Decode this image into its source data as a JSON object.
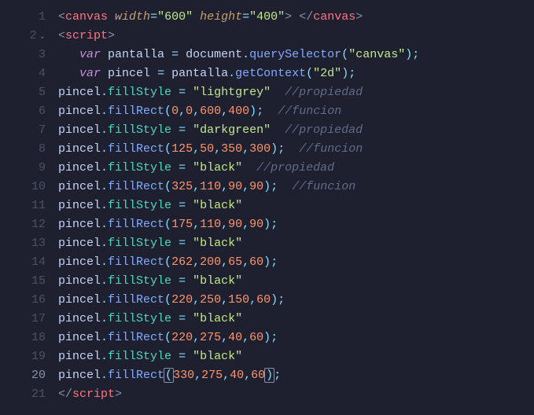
{
  "tokens": [
    [
      {
        "c": "c-bracket",
        "t": "<"
      },
      {
        "c": "c-tag",
        "t": "canvas"
      },
      {
        "c": "",
        "t": " "
      },
      {
        "c": "c-attr",
        "t": "width"
      },
      {
        "c": "c-op",
        "t": "="
      },
      {
        "c": "c-string",
        "t": "\"600\""
      },
      {
        "c": "",
        "t": " "
      },
      {
        "c": "c-attr",
        "t": "height"
      },
      {
        "c": "c-op",
        "t": "="
      },
      {
        "c": "c-string",
        "t": "\"400\""
      },
      {
        "c": "c-bracket",
        "t": ">"
      },
      {
        "c": "",
        "t": " "
      },
      {
        "c": "c-bracket",
        "t": "</"
      },
      {
        "c": "c-tag",
        "t": "canvas"
      },
      {
        "c": "c-bracket",
        "t": ">"
      }
    ],
    [
      {
        "c": "c-bracket",
        "t": "<"
      },
      {
        "c": "c-tag",
        "t": "script"
      },
      {
        "c": "c-bracket",
        "t": ">"
      }
    ],
    [
      {
        "c": "",
        "t": "   "
      },
      {
        "c": "c-var",
        "t": "var"
      },
      {
        "c": "",
        "t": " "
      },
      {
        "c": "c-ident",
        "t": "pantalla"
      },
      {
        "c": "",
        "t": " "
      },
      {
        "c": "c-op",
        "t": "="
      },
      {
        "c": "",
        "t": " "
      },
      {
        "c": "c-ident",
        "t": "document"
      },
      {
        "c": "c-punc",
        "t": "."
      },
      {
        "c": "c-func",
        "t": "querySelector"
      },
      {
        "c": "c-punc",
        "t": "("
      },
      {
        "c": "c-string",
        "t": "\"canvas\""
      },
      {
        "c": "c-punc",
        "t": ")"
      },
      {
        "c": "c-punc",
        "t": ";"
      }
    ],
    [
      {
        "c": "",
        "t": "   "
      },
      {
        "c": "c-var",
        "t": "var"
      },
      {
        "c": "",
        "t": " "
      },
      {
        "c": "c-ident",
        "t": "pincel"
      },
      {
        "c": "",
        "t": " "
      },
      {
        "c": "c-op",
        "t": "="
      },
      {
        "c": "",
        "t": " "
      },
      {
        "c": "c-ident",
        "t": "pantalla"
      },
      {
        "c": "c-punc",
        "t": "."
      },
      {
        "c": "c-func",
        "t": "getContext"
      },
      {
        "c": "c-punc",
        "t": "("
      },
      {
        "c": "c-string",
        "t": "\"2d\""
      },
      {
        "c": "c-punc",
        "t": ")"
      },
      {
        "c": "c-punc",
        "t": ";"
      }
    ],
    [
      {
        "c": "c-ident",
        "t": "pincel"
      },
      {
        "c": "c-punc",
        "t": "."
      },
      {
        "c": "c-prop",
        "t": "fillStyle"
      },
      {
        "c": "",
        "t": " "
      },
      {
        "c": "c-op",
        "t": "="
      },
      {
        "c": "",
        "t": " "
      },
      {
        "c": "c-string",
        "t": "\"lightgrey\""
      },
      {
        "c": "",
        "t": "  "
      },
      {
        "c": "c-comment",
        "t": "//propiedad"
      }
    ],
    [
      {
        "c": "c-ident",
        "t": "pincel"
      },
      {
        "c": "c-punc",
        "t": "."
      },
      {
        "c": "c-func",
        "t": "fillRect"
      },
      {
        "c": "c-punc",
        "t": "("
      },
      {
        "c": "c-num",
        "t": "0"
      },
      {
        "c": "c-punc",
        "t": ","
      },
      {
        "c": "c-num",
        "t": "0"
      },
      {
        "c": "c-punc",
        "t": ","
      },
      {
        "c": "c-num",
        "t": "600"
      },
      {
        "c": "c-punc",
        "t": ","
      },
      {
        "c": "c-num",
        "t": "400"
      },
      {
        "c": "c-punc",
        "t": ")"
      },
      {
        "c": "c-punc",
        "t": ";"
      },
      {
        "c": "",
        "t": "  "
      },
      {
        "c": "c-comment",
        "t": "//funcion"
      }
    ],
    [
      {
        "c": "c-ident",
        "t": "pincel"
      },
      {
        "c": "c-punc",
        "t": "."
      },
      {
        "c": "c-prop",
        "t": "fillStyle"
      },
      {
        "c": "",
        "t": " "
      },
      {
        "c": "c-op",
        "t": "="
      },
      {
        "c": "",
        "t": " "
      },
      {
        "c": "c-string",
        "t": "\"darkgreen\""
      },
      {
        "c": "",
        "t": "  "
      },
      {
        "c": "c-comment",
        "t": "//propiedad"
      }
    ],
    [
      {
        "c": "c-ident",
        "t": "pincel"
      },
      {
        "c": "c-punc",
        "t": "."
      },
      {
        "c": "c-func",
        "t": "fillRect"
      },
      {
        "c": "c-punc",
        "t": "("
      },
      {
        "c": "c-num",
        "t": "125"
      },
      {
        "c": "c-punc",
        "t": ","
      },
      {
        "c": "c-num",
        "t": "50"
      },
      {
        "c": "c-punc",
        "t": ","
      },
      {
        "c": "c-num",
        "t": "350"
      },
      {
        "c": "c-punc",
        "t": ","
      },
      {
        "c": "c-num",
        "t": "300"
      },
      {
        "c": "c-punc",
        "t": ")"
      },
      {
        "c": "c-punc",
        "t": ";"
      },
      {
        "c": "",
        "t": "  "
      },
      {
        "c": "c-comment",
        "t": "//funcion"
      }
    ],
    [
      {
        "c": "c-ident",
        "t": "pincel"
      },
      {
        "c": "c-punc",
        "t": "."
      },
      {
        "c": "c-prop",
        "t": "fillStyle"
      },
      {
        "c": "",
        "t": " "
      },
      {
        "c": "c-op",
        "t": "="
      },
      {
        "c": "",
        "t": " "
      },
      {
        "c": "c-string",
        "t": "\"black\""
      },
      {
        "c": "",
        "t": "  "
      },
      {
        "c": "c-comment",
        "t": "//propiedad"
      }
    ],
    [
      {
        "c": "c-ident",
        "t": "pincel"
      },
      {
        "c": "c-punc",
        "t": "."
      },
      {
        "c": "c-func",
        "t": "fillRect"
      },
      {
        "c": "c-punc",
        "t": "("
      },
      {
        "c": "c-num",
        "t": "325"
      },
      {
        "c": "c-punc",
        "t": ","
      },
      {
        "c": "c-num",
        "t": "110"
      },
      {
        "c": "c-punc",
        "t": ","
      },
      {
        "c": "c-num",
        "t": "90"
      },
      {
        "c": "c-punc",
        "t": ","
      },
      {
        "c": "c-num",
        "t": "90"
      },
      {
        "c": "c-punc",
        "t": ")"
      },
      {
        "c": "c-punc",
        "t": ";"
      },
      {
        "c": "",
        "t": "  "
      },
      {
        "c": "c-comment",
        "t": "//funcion"
      }
    ],
    [
      {
        "c": "c-ident",
        "t": "pincel"
      },
      {
        "c": "c-punc",
        "t": "."
      },
      {
        "c": "c-prop",
        "t": "fillStyle"
      },
      {
        "c": "",
        "t": " "
      },
      {
        "c": "c-op",
        "t": "="
      },
      {
        "c": "",
        "t": " "
      },
      {
        "c": "c-string",
        "t": "\"black\""
      }
    ],
    [
      {
        "c": "c-ident",
        "t": "pincel"
      },
      {
        "c": "c-punc",
        "t": "."
      },
      {
        "c": "c-func",
        "t": "fillRect"
      },
      {
        "c": "c-punc",
        "t": "("
      },
      {
        "c": "c-num",
        "t": "175"
      },
      {
        "c": "c-punc",
        "t": ","
      },
      {
        "c": "c-num",
        "t": "110"
      },
      {
        "c": "c-punc",
        "t": ","
      },
      {
        "c": "c-num",
        "t": "90"
      },
      {
        "c": "c-punc",
        "t": ","
      },
      {
        "c": "c-num",
        "t": "90"
      },
      {
        "c": "c-punc",
        "t": ")"
      },
      {
        "c": "c-punc",
        "t": ";"
      }
    ],
    [
      {
        "c": "c-ident",
        "t": "pincel"
      },
      {
        "c": "c-punc",
        "t": "."
      },
      {
        "c": "c-prop",
        "t": "fillStyle"
      },
      {
        "c": "",
        "t": " "
      },
      {
        "c": "c-op",
        "t": "="
      },
      {
        "c": "",
        "t": " "
      },
      {
        "c": "c-string",
        "t": "\"black\""
      }
    ],
    [
      {
        "c": "c-ident",
        "t": "pincel"
      },
      {
        "c": "c-punc",
        "t": "."
      },
      {
        "c": "c-func",
        "t": "fillRect"
      },
      {
        "c": "c-punc",
        "t": "("
      },
      {
        "c": "c-num",
        "t": "262"
      },
      {
        "c": "c-punc",
        "t": ","
      },
      {
        "c": "c-num",
        "t": "200"
      },
      {
        "c": "c-punc",
        "t": ","
      },
      {
        "c": "c-num",
        "t": "65"
      },
      {
        "c": "c-punc",
        "t": ","
      },
      {
        "c": "c-num",
        "t": "60"
      },
      {
        "c": "c-punc",
        "t": ")"
      },
      {
        "c": "c-punc",
        "t": ";"
      }
    ],
    [
      {
        "c": "c-ident",
        "t": "pincel"
      },
      {
        "c": "c-punc",
        "t": "."
      },
      {
        "c": "c-prop",
        "t": "fillStyle"
      },
      {
        "c": "",
        "t": " "
      },
      {
        "c": "c-op",
        "t": "="
      },
      {
        "c": "",
        "t": " "
      },
      {
        "c": "c-string",
        "t": "\"black\""
      }
    ],
    [
      {
        "c": "c-ident",
        "t": "pincel"
      },
      {
        "c": "c-punc",
        "t": "."
      },
      {
        "c": "c-func",
        "t": "fillRect"
      },
      {
        "c": "c-punc",
        "t": "("
      },
      {
        "c": "c-num",
        "t": "220"
      },
      {
        "c": "c-punc",
        "t": ","
      },
      {
        "c": "c-num",
        "t": "250"
      },
      {
        "c": "c-punc",
        "t": ","
      },
      {
        "c": "c-num",
        "t": "150"
      },
      {
        "c": "c-punc",
        "t": ","
      },
      {
        "c": "c-num",
        "t": "60"
      },
      {
        "c": "c-punc",
        "t": ")"
      },
      {
        "c": "c-punc",
        "t": ";"
      }
    ],
    [
      {
        "c": "c-ident",
        "t": "pincel"
      },
      {
        "c": "c-punc",
        "t": "."
      },
      {
        "c": "c-prop",
        "t": "fillStyle"
      },
      {
        "c": "",
        "t": " "
      },
      {
        "c": "c-op",
        "t": "="
      },
      {
        "c": "",
        "t": " "
      },
      {
        "c": "c-string",
        "t": "\"black\""
      }
    ],
    [
      {
        "c": "c-ident",
        "t": "pincel"
      },
      {
        "c": "c-punc",
        "t": "."
      },
      {
        "c": "c-func",
        "t": "fillRect"
      },
      {
        "c": "c-punc",
        "t": "("
      },
      {
        "c": "c-num",
        "t": "220"
      },
      {
        "c": "c-punc",
        "t": ","
      },
      {
        "c": "c-num",
        "t": "275"
      },
      {
        "c": "c-punc",
        "t": ","
      },
      {
        "c": "c-num",
        "t": "40"
      },
      {
        "c": "c-punc",
        "t": ","
      },
      {
        "c": "c-num",
        "t": "60"
      },
      {
        "c": "c-punc",
        "t": ")"
      },
      {
        "c": "c-punc",
        "t": ";"
      }
    ],
    [
      {
        "c": "c-ident",
        "t": "pincel"
      },
      {
        "c": "c-punc",
        "t": "."
      },
      {
        "c": "c-prop",
        "t": "fillStyle"
      },
      {
        "c": "",
        "t": " "
      },
      {
        "c": "c-op",
        "t": "="
      },
      {
        "c": "",
        "t": " "
      },
      {
        "c": "c-string",
        "t": "\"black\""
      }
    ],
    [
      {
        "c": "c-ident",
        "t": "pincel"
      },
      {
        "c": "c-punc",
        "t": "."
      },
      {
        "c": "c-func",
        "t": "fillRect"
      },
      {
        "c": "c-punc cursor-box",
        "t": "("
      },
      {
        "c": "c-num",
        "t": "330"
      },
      {
        "c": "c-punc",
        "t": ","
      },
      {
        "c": "c-num",
        "t": "275"
      },
      {
        "c": "c-punc",
        "t": ","
      },
      {
        "c": "c-num",
        "t": "40"
      },
      {
        "c": "c-punc",
        "t": ","
      },
      {
        "c": "c-num",
        "t": "60"
      },
      {
        "c": "c-punc cursor-box",
        "t": ")"
      },
      {
        "c": "c-punc",
        "t": ";"
      }
    ],
    [
      {
        "c": "c-bracket",
        "t": "</"
      },
      {
        "c": "c-tag",
        "t": "script"
      },
      {
        "c": "c-bracket",
        "t": ">"
      }
    ]
  ],
  "gutter": {
    "lines": [
      "1",
      "2",
      "3",
      "4",
      "5",
      "6",
      "7",
      "8",
      "9",
      "10",
      "11",
      "12",
      "13",
      "14",
      "15",
      "16",
      "17",
      "18",
      "19",
      "20",
      "21"
    ],
    "fold_at": 2,
    "active": 20
  }
}
